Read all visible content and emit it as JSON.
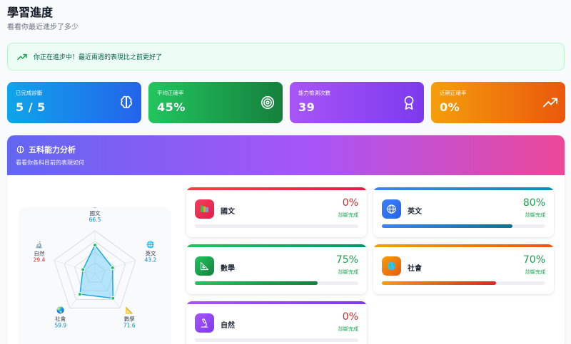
{
  "header": {
    "title": "學習進度",
    "subtitle": "看看你最近進步了多少"
  },
  "banner": {
    "text": "你正在進步中！最近兩週的表現比之前更好了",
    "icon": "trending-up-icon"
  },
  "stats": [
    {
      "label": "已完成診斷",
      "value": "5 / 5",
      "icon": "brain-icon"
    },
    {
      "label": "平均正確率",
      "value": "45%",
      "icon": "target-icon"
    },
    {
      "label": "能力檢測次數",
      "value": "39",
      "icon": "award-icon"
    },
    {
      "label": "近期正確率",
      "value": "0%",
      "icon": "trending-up-icon"
    }
  ],
  "panel": {
    "title": "五科能力分析",
    "subtitle": "看看你各科目前的表現如何"
  },
  "radar": [
    {
      "subject": "國文",
      "value": "66.5",
      "score": 66.5,
      "color": "#0284c7"
    },
    {
      "subject": "英文",
      "value": "43.2",
      "score": 43.2,
      "color": "#0284c7"
    },
    {
      "subject": "數學",
      "value": "71.6",
      "score": 71.6,
      "color": "#0284c7"
    },
    {
      "subject": "社會",
      "value": "59.9",
      "score": 59.9,
      "color": "#0284c7"
    },
    {
      "subject": "自然",
      "value": "29.4",
      "score": 29.4,
      "color": "#dc2626"
    }
  ],
  "subjects": [
    {
      "name": "國文",
      "percent": "0%",
      "progress": 0,
      "status": "診斷完成",
      "color": "#dc2626",
      "icon": "books-icon"
    },
    {
      "name": "英文",
      "percent": "80%",
      "progress": 80,
      "status": "診斷完成",
      "color": "#16a34a",
      "icon": "globe-icon"
    },
    {
      "name": "數學",
      "percent": "75%",
      "progress": 75,
      "status": "診斷完成",
      "color": "#16a34a",
      "icon": "triangle-ruler-icon"
    },
    {
      "name": "社會",
      "percent": "70%",
      "progress": 70,
      "status": "診斷完成",
      "color": "#16a34a",
      "icon": "earth-icon"
    },
    {
      "name": "自然",
      "percent": "0%",
      "progress": 0,
      "status": "診斷完成",
      "color": "#dc2626",
      "icon": "microscope-icon"
    }
  ]
}
